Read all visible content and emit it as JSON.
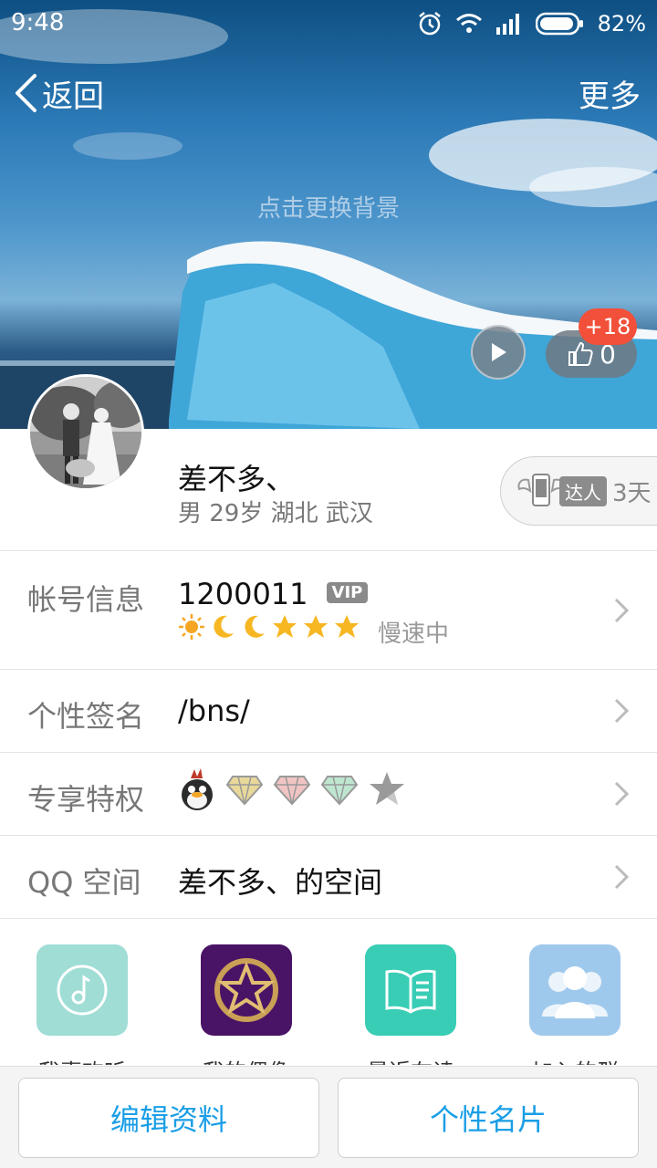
{
  "status_bar": {
    "time": "9:48",
    "battery": "82%"
  },
  "nav": {
    "back_label": "返回",
    "more_label": "更多"
  },
  "cover": {
    "change_bg_hint": "点击更换背景",
    "like_count": "0",
    "like_badge": "+18"
  },
  "profile": {
    "nickname": "差不多、",
    "info": "男 29岁 湖北 武汉",
    "talent_tag": "达人",
    "talent_days": "3天"
  },
  "rows": {
    "account": {
      "label": "帐号信息",
      "value": "1200011",
      "vip": "VIP",
      "speed": "慢速中"
    },
    "signature": {
      "label": "个性签名",
      "value": "/bns/"
    },
    "privilege": {
      "label": "专享特权"
    },
    "qzone": {
      "label": "QQ 空间",
      "value": "差不多、的空间"
    }
  },
  "apps": [
    {
      "label": "我喜欢听",
      "icon": "music-note-icon",
      "color": "#9fddd5"
    },
    {
      "label": "我的偶像",
      "icon": "star-idol-icon",
      "color": "#4a1466"
    },
    {
      "label": "最近在读",
      "icon": "book-icon",
      "color": "#39cdb5"
    },
    {
      "label": "加入的群",
      "icon": "group-icon",
      "color": "#9fc9ec"
    }
  ],
  "bottom": {
    "edit_label": "编辑资料",
    "card_label": "个性名片"
  },
  "colors": {
    "accent": "#1a9ee6",
    "badge": "#f2503a"
  }
}
